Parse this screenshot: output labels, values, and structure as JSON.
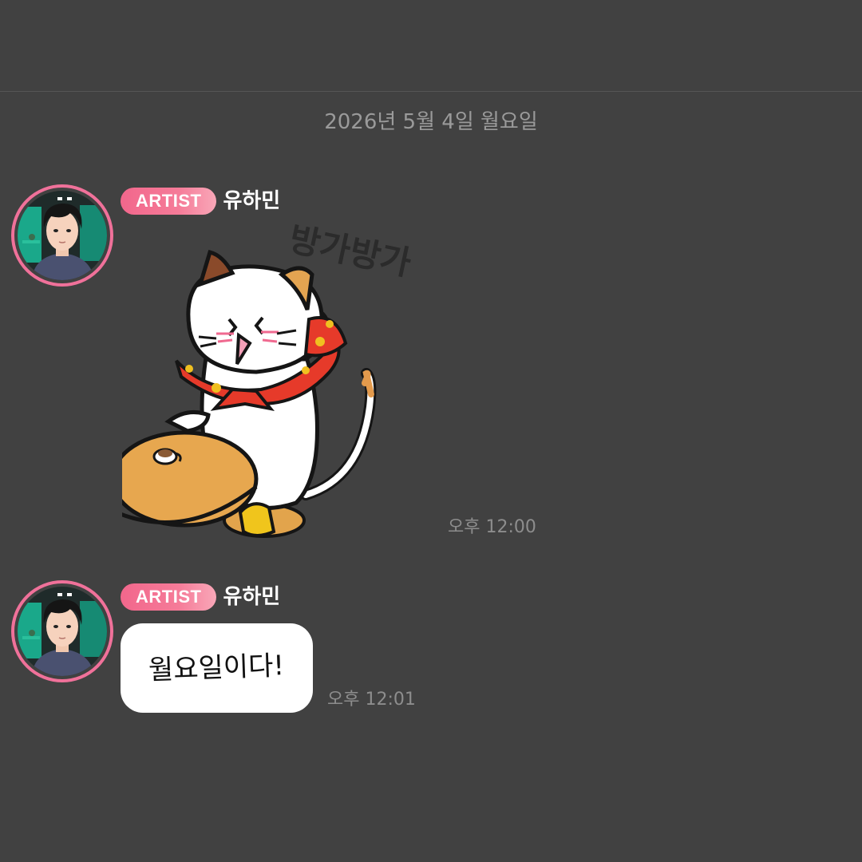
{
  "date_separator": "2026년 5월 4일 월요일",
  "messages": [
    {
      "type": "sticker",
      "badge": "ARTIST",
      "sender": "유하민",
      "sticker_icon": "cat-waving-sticker",
      "sticker_text": "방가방가",
      "time": "오후 12:00"
    },
    {
      "type": "text",
      "badge": "ARTIST",
      "sender": "유하민",
      "text": "월요일이다!",
      "time": "오후 12:01"
    }
  ],
  "colors": {
    "background": "#414141",
    "badge": "#f2678c",
    "avatar_ring": "#f0719a",
    "bubble": "#ffffff",
    "timestamp": "#8d8d8d"
  }
}
